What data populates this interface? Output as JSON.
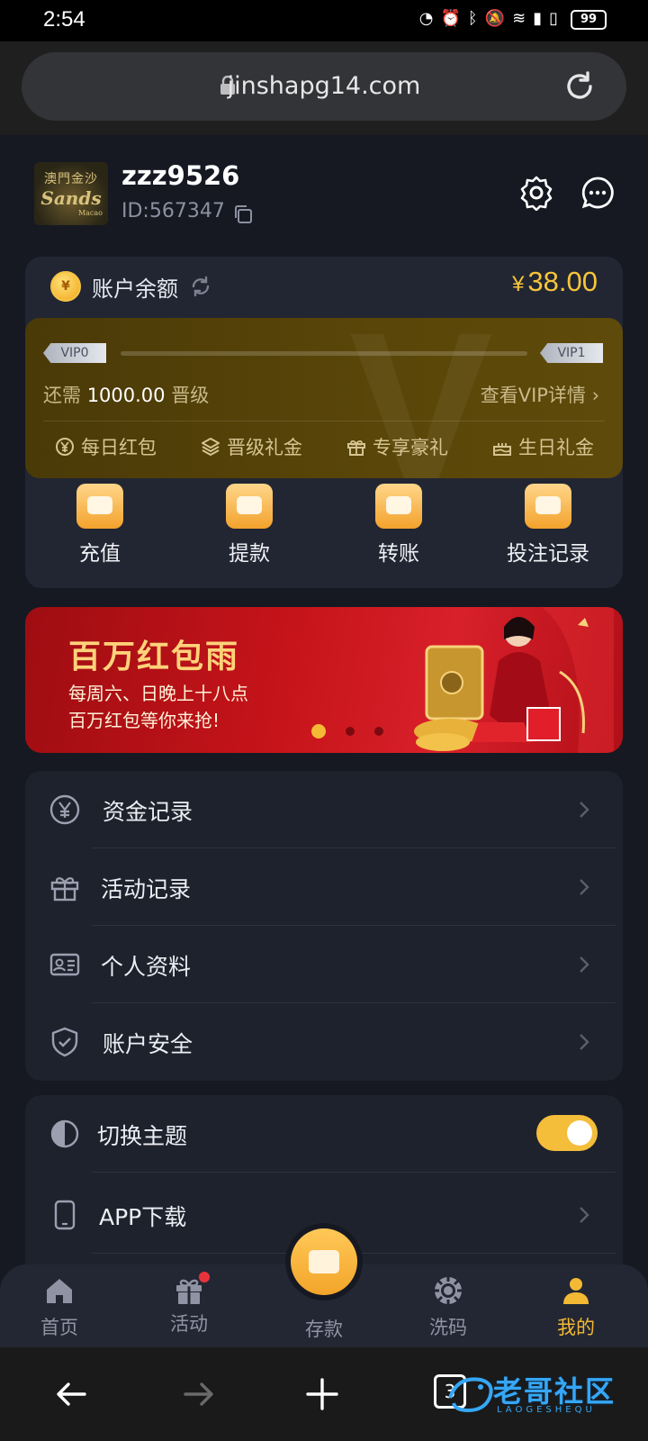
{
  "statusbar": {
    "time": "2:54",
    "battery": "99"
  },
  "browser": {
    "url": "jinshapg14.com",
    "tabs_count": "3"
  },
  "profile": {
    "logo_line1": "澳門金沙",
    "logo_line2": "Sands",
    "logo_line3": "Macao",
    "username": "zzz9526",
    "user_id": "ID:567347"
  },
  "balance": {
    "label": "账户余额",
    "currency": "¥",
    "amount": "38.00"
  },
  "vip": {
    "current": "VIP0",
    "next": "VIP1",
    "progress": 0,
    "need_prefix": "还需",
    "need_amount": "1000.00",
    "need_suffix": "晋级",
    "detail_link": "查看VIP详情 ›",
    "perks": [
      "每日红包",
      "晋级礼金",
      "专享豪礼",
      "生日礼金"
    ]
  },
  "actions": [
    "充值",
    "提款",
    "转账",
    "投注记录"
  ],
  "banner": {
    "title": "百万红包雨",
    "line1": "每周六、日晚上十八点",
    "line2": "百万红包等你来抢!",
    "active_slide": 0,
    "slide_count": 3
  },
  "menu_section1": [
    "资金记录",
    "活动记录",
    "个人资料",
    "账户安全"
  ],
  "menu_section2": {
    "theme_label": "切换主题",
    "theme_on": true,
    "app_label": "APP下载"
  },
  "tabbar": {
    "home": "首页",
    "activity": "活动",
    "deposit": "存款",
    "rebate": "洗码",
    "mine": "我的",
    "active": "mine"
  },
  "colors": {
    "accent": "#f4b934",
    "background": "#161922",
    "card": "#222633",
    "banner_red": "#c7141a"
  },
  "watermark": {
    "text": "老哥社区",
    "sub": "LAOGESHEQU"
  }
}
